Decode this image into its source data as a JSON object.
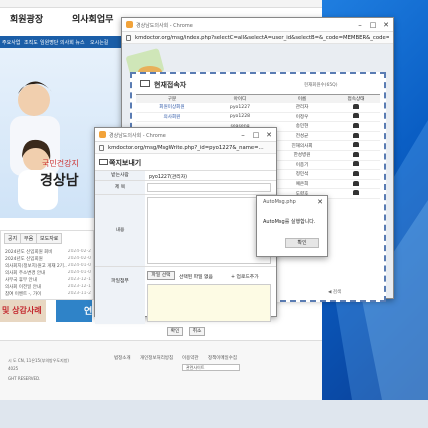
{
  "site": {
    "tabs": [
      "회원광장",
      "의사회업무"
    ],
    "nav": [
      "주요사업",
      "조직도",
      "임원명단",
      "의사회 뉴스",
      "오시는길"
    ],
    "hero_line1": "국민건강지",
    "hero_line2": "경상남",
    "notice_tabs": [
      "공지",
      "부음",
      "보도자료"
    ],
    "notices": [
      {
        "title": "2024년도 신입회원 회비",
        "date": "2024-02-2"
      },
      {
        "title": "2024년도 신입회원",
        "date": "2024-02-0"
      },
      {
        "title": "의사회지(정보지)원고 게재 2기..",
        "date": "2024-01-0"
      },
      {
        "title": "의사회 주소변경 안내",
        "date": "2024-01-0"
      },
      {
        "title": "사무국 휴무 안내",
        "date": "2023-12-1"
      },
      {
        "title": "의사회 이전일 안내",
        "date": "2023-12-1"
      },
      {
        "title": "참여 이벤트 -, 가이",
        "date": "2023-11-2"
      }
    ],
    "banner_red": "및 상감사례",
    "banner_blue": "연",
    "footer_links": [
      "법정소개",
      "개인정보처리방침",
      "이용약관",
      "정책이메일수집"
    ],
    "footer_lines": [
      "시 도 CN, 11은15(부의방우도지방)",
      "4025",
      "GHT RESERVED."
    ],
    "footer_select": "관련사이트"
  },
  "win1": {
    "title": "경상남도의사회 - Chrome",
    "url": "kmdoctor.org/msg/index.php?selectC=all&selectA=user_id&selectB=&_code=MEMBER&_code=L",
    "panel_title": "현재접속자",
    "count": "현재회원수(65Q)",
    "columns": [
      "구분",
      "아이디",
      "이름",
      "접속상태"
    ],
    "rows": [
      {
        "group": "회원미상회원",
        "id": "pyo1227",
        "name": "관리자"
      },
      {
        "group": "의사회원",
        "id": "pyo1228",
        "name": "이정우"
      },
      {
        "group": "",
        "id": "seaseng",
        "name": "송민현"
      },
      {
        "group": "",
        "id": "dcyichoi",
        "name": "전성균"
      },
      {
        "group": "",
        "id": "jinhee",
        "name": "진해의사회"
      },
      {
        "group": "",
        "id": "hanseung",
        "name": "한성병원"
      },
      {
        "group": "",
        "id": "hanolee",
        "name": "이종기"
      },
      {
        "group": "",
        "id": "",
        "name": "정민석"
      },
      {
        "group": "",
        "id": "",
        "name": "예은희"
      },
      {
        "group": "",
        "id": "",
        "name": "도향호"
      }
    ],
    "pager": "◀ 검색"
  },
  "win2": {
    "title": "경상남도의사회 - Chrome",
    "url": "kmdoctor.org/msg/MsgWrite.php?_id=pyo1227&_name=...",
    "heading": "쪽지보내기",
    "labels": {
      "to": "받는사람",
      "subject": "제 목",
      "content": "내용",
      "attach": "파일첨부"
    },
    "to_value": "pyo1227(관리자)",
    "file_button": "파일 선택",
    "file_none": "선택된 파일 없음",
    "add_upload": "+ 업로드추가",
    "confirm": "확인",
    "cancel": "취소"
  },
  "alert": {
    "title": "AutoMsg.php",
    "message": "AutoMsg를 실행합니다.",
    "ok": "확인"
  },
  "colors": {
    "nav": "#1b5ea8",
    "desktop": "#0a5ec4",
    "panel_border": "#5a7cb3"
  }
}
